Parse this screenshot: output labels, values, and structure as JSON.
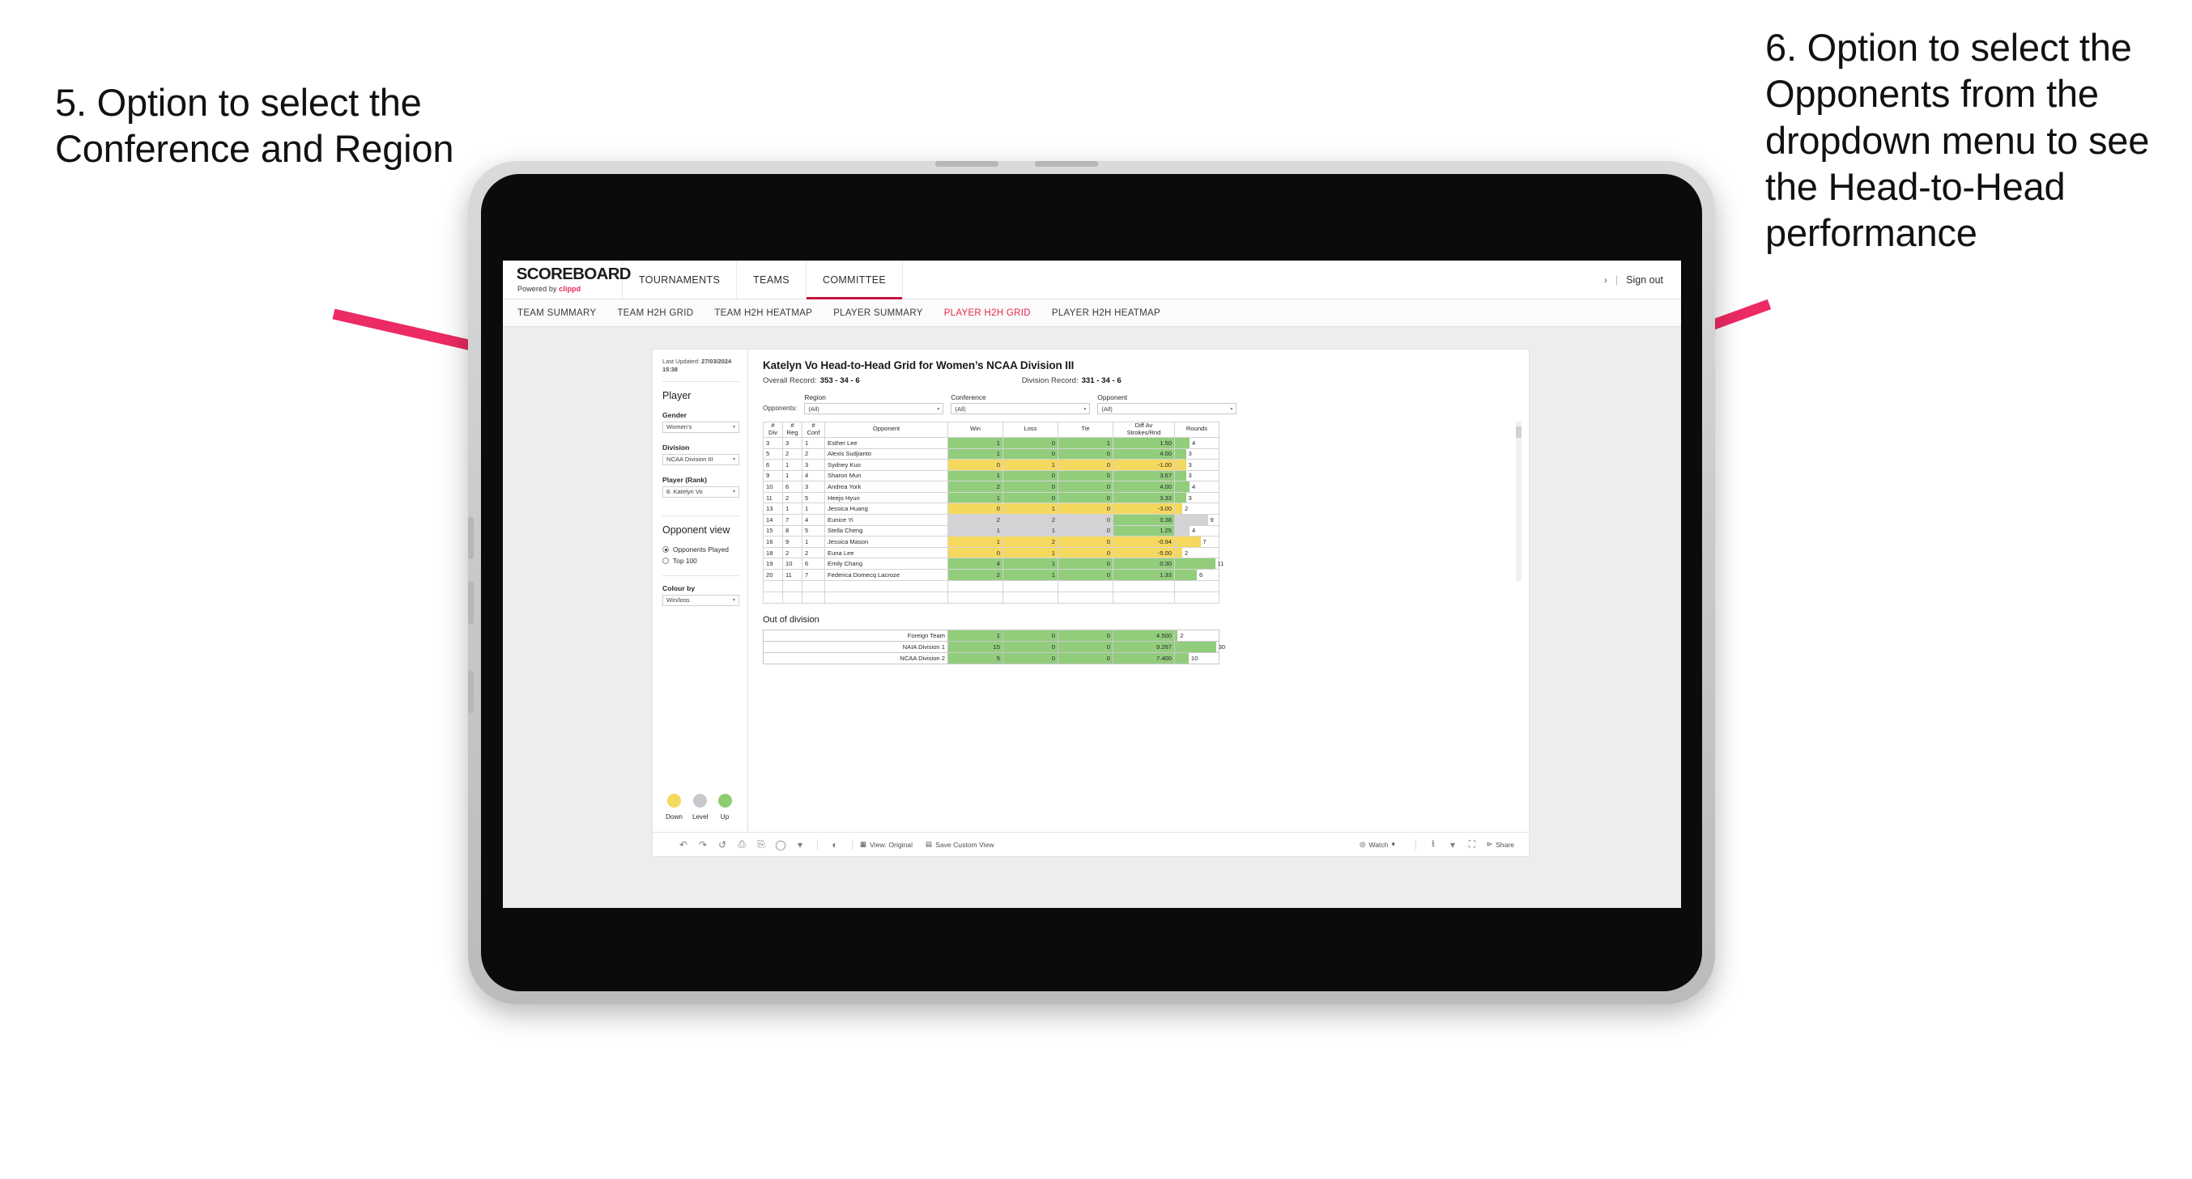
{
  "annotations": {
    "left": "5. Option to select the Conference and Region",
    "right": "6. Option to select the Opponents from the dropdown menu to see the Head-to-Head performance"
  },
  "colors": {
    "accent_red": "#e8264f",
    "active_underline": "#c0143c",
    "win_green": "#92cd7c",
    "loss_yellow": "#f5d85e",
    "level_grey": "#d3d3d5",
    "arrow_pink": "#ec2a63"
  },
  "brand": {
    "logo": "SCOREBOARD",
    "powered_prefix": "Powered by ",
    "powered_brand": "clippd"
  },
  "topnav": {
    "items": [
      {
        "label": "TOURNAMENTS",
        "active": false
      },
      {
        "label": "TEAMS",
        "active": false
      },
      {
        "label": "COMMITTEE",
        "active": true
      }
    ],
    "chevron": "›",
    "separator": "|",
    "signout": "Sign out"
  },
  "subnav": {
    "items": [
      {
        "label": "TEAM SUMMARY",
        "active": false
      },
      {
        "label": "TEAM H2H GRID",
        "active": false
      },
      {
        "label": "TEAM H2H HEATMAP",
        "active": false
      },
      {
        "label": "PLAYER SUMMARY",
        "active": false
      },
      {
        "label": "PLAYER H2H GRID",
        "active": true
      },
      {
        "label": "PLAYER H2H HEATMAP",
        "active": false
      }
    ]
  },
  "sidebar": {
    "last_updated_label": "Last Updated: ",
    "last_updated_value": "27/03/2024",
    "last_updated_time": "15:38",
    "player_heading": "Player",
    "gender_label": "Gender",
    "gender_value": "Women’s",
    "division_label": "Division",
    "division_value": "NCAA Division III",
    "player_rank_label": "Player (Rank)",
    "player_rank_value": "8. Katelyn Vo",
    "opponent_view_heading": "Opponent view",
    "opponent_view_options": [
      {
        "label": "Opponents Played",
        "selected": true
      },
      {
        "label": "Top 100",
        "selected": false
      }
    ],
    "colour_by_label": "Colour by",
    "colour_by_value": "Win/loss",
    "legend": [
      {
        "label": "Down",
        "color": "#f5d85e"
      },
      {
        "label": "Level",
        "color": "#c9c9cd"
      },
      {
        "label": "Up",
        "color": "#8dcc6f"
      }
    ],
    "caret": "▾"
  },
  "main": {
    "title": "Katelyn Vo Head-to-Head Grid for Women’s NCAA Division III",
    "overall_record_label": "Overall Record:",
    "overall_record_value": "353 - 34 - 6",
    "division_record_label": "Division Record:",
    "division_record_value": "331 - 34 - 6",
    "opponents_label": "Opponents:",
    "filters": [
      {
        "name": "region",
        "title": "Region",
        "value": "(All)"
      },
      {
        "name": "conference",
        "title": "Conference",
        "value": "(All)"
      },
      {
        "name": "opponent",
        "title": "Opponent",
        "value": "(All)"
      }
    ],
    "caret": "▾"
  },
  "grid": {
    "headers": [
      {
        "l1": "#",
        "l2": "Div"
      },
      {
        "l1": "#",
        "l2": "Reg"
      },
      {
        "l1": "#",
        "l2": "Conf"
      },
      {
        "l1": "Opponent",
        "l2": ""
      },
      {
        "l1": "Win",
        "l2": ""
      },
      {
        "l1": "Loss",
        "l2": ""
      },
      {
        "l1": "Tie",
        "l2": ""
      },
      {
        "l1": "Diff Av",
        "l2": "Strokes/Rnd"
      },
      {
        "l1": "Rounds",
        "l2": ""
      }
    ],
    "rows": [
      {
        "div": "3",
        "reg": "3",
        "conf": "1",
        "opponent": "Esther Lee",
        "win": "1",
        "loss": "0",
        "tie": "1",
        "diff": "1.50",
        "rounds": "4",
        "color": "green"
      },
      {
        "div": "5",
        "reg": "2",
        "conf": "2",
        "opponent": "Alexis Sudjianto",
        "win": "1",
        "loss": "0",
        "tie": "0",
        "diff": "4.00",
        "rounds": "3",
        "color": "green"
      },
      {
        "div": "6",
        "reg": "1",
        "conf": "3",
        "opponent": "Sydney Kuo",
        "win": "0",
        "loss": "1",
        "tie": "0",
        "diff": "-1.00",
        "rounds": "3",
        "color": "yellow"
      },
      {
        "div": "9",
        "reg": "1",
        "conf": "4",
        "opponent": "Sharon Mun",
        "win": "1",
        "loss": "0",
        "tie": "0",
        "diff": "3.67",
        "rounds": "3",
        "color": "green"
      },
      {
        "div": "10",
        "reg": "6",
        "conf": "3",
        "opponent": "Andrea York",
        "win": "2",
        "loss": "0",
        "tie": "0",
        "diff": "4.00",
        "rounds": "4",
        "color": "green"
      },
      {
        "div": "11",
        "reg": "2",
        "conf": "5",
        "opponent": "Heejo Hyun",
        "win": "1",
        "loss": "0",
        "tie": "0",
        "diff": "3.33",
        "rounds": "3",
        "color": "green"
      },
      {
        "div": "13",
        "reg": "1",
        "conf": "1",
        "opponent": "Jessica Huang",
        "win": "0",
        "loss": "1",
        "tie": "0",
        "diff": "-3.00",
        "rounds": "2",
        "color": "yellow"
      },
      {
        "div": "14",
        "reg": "7",
        "conf": "4",
        "opponent": "Eunice Yi",
        "win": "2",
        "loss": "2",
        "tie": "0",
        "diff": "0.38",
        "rounds": "9",
        "color": "grey",
        "diff_color": "green"
      },
      {
        "div": "15",
        "reg": "8",
        "conf": "5",
        "opponent": "Stella Cheng",
        "win": "1",
        "loss": "1",
        "tie": "0",
        "diff": "1.25",
        "rounds": "4",
        "color": "grey",
        "diff_color": "green"
      },
      {
        "div": "16",
        "reg": "9",
        "conf": "1",
        "opponent": "Jessica Mason",
        "win": "1",
        "loss": "2",
        "tie": "0",
        "diff": "-0.94",
        "rounds": "7",
        "color": "yellow"
      },
      {
        "div": "18",
        "reg": "2",
        "conf": "2",
        "opponent": "Euna Lee",
        "win": "0",
        "loss": "1",
        "tie": "0",
        "diff": "-5.00",
        "rounds": "2",
        "color": "yellow"
      },
      {
        "div": "19",
        "reg": "10",
        "conf": "6",
        "opponent": "Emily Chang",
        "win": "4",
        "loss": "1",
        "tie": "0",
        "diff": "0.30",
        "rounds": "11",
        "color": "green"
      },
      {
        "div": "20",
        "reg": "11",
        "conf": "7",
        "opponent": "Federica Domecq Lacroze",
        "win": "2",
        "loss": "1",
        "tie": "0",
        "diff": "1.33",
        "rounds": "6",
        "color": "green"
      }
    ],
    "max_rounds": 12
  },
  "out_of_division": {
    "title": "Out of division",
    "rows": [
      {
        "name": "Foreign Team",
        "win": "1",
        "loss": "0",
        "tie": "0",
        "diff": "4.500",
        "rounds": "2",
        "color": "green"
      },
      {
        "name": "NAIA Division 1",
        "win": "15",
        "loss": "0",
        "tie": "0",
        "diff": "9.267",
        "rounds": "30",
        "color": "green"
      },
      {
        "name": "NCAA Division 2",
        "win": "5",
        "loss": "0",
        "tie": "0",
        "diff": "7.400",
        "rounds": "10",
        "color": "green"
      }
    ],
    "max_rounds": 32
  },
  "toolbar": {
    "icons": [
      "undo-icon",
      "redo-icon",
      "revert-icon",
      "refresh-icon",
      "pause-icon",
      "shape-icon",
      "shape-caret-icon",
      "share-circle-icon"
    ],
    "view_label": "View: Original",
    "save_label": "Save Custom View",
    "watch_label": "Watch",
    "download_label": "download-icon",
    "fullscreen_label": "fullscreen-icon",
    "share_label": "Share"
  }
}
